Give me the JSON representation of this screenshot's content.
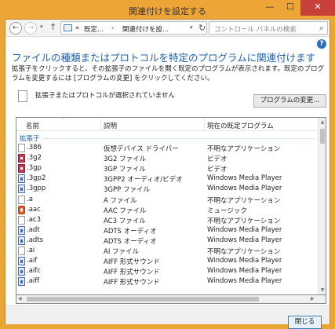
{
  "window": {
    "title": "関連付けを設定する"
  },
  "titlebar": {
    "min": "—",
    "max": "☐",
    "close": "✕"
  },
  "nav": {
    "back": "←",
    "forward": "→",
    "recent": "▾",
    "up": "↑",
    "address": {
      "overflow": "«",
      "crumb1": "既定...",
      "sep": "›",
      "crumb2": "関連付けを設...",
      "chev": "▾",
      "refresh": "↻"
    },
    "search_placeholder": "コントロール パネルの検索"
  },
  "help": "?",
  "heading": "ファイルの種類またはプロトコルを特定のプログラムに関連付けます",
  "description": "拡張子をクリックすると、その拡張子のファイルを開く既定のプログラムが表示されます。既定のプログラムを変更するには [プログラムの変更] をクリックしてください。",
  "selection_text": "拡張子またはプロトコルが選択されていません",
  "change_button": "プログラムの変更...",
  "table": {
    "headers": {
      "name": "名前",
      "description": "説明",
      "program": "現在の既定プログラム"
    },
    "sort": "⌃",
    "group": "拡張子",
    "rows": [
      {
        "name": ".386",
        "description": "仮想デバイス ドライバー",
        "program": "不明なアプリケーション",
        "icon": "doc"
      },
      {
        "name": ".3g2",
        "description": "3G2 ファイル",
        "program": "ビデオ",
        "icon": "red"
      },
      {
        "name": ".3gp",
        "description": "3GP ファイル",
        "program": "ビデオ",
        "icon": "red"
      },
      {
        "name": ".3gp2",
        "description": "3GPP2 オーディオ/ビデオ",
        "program": "Windows Media Player",
        "icon": "blue"
      },
      {
        "name": ".3gpp",
        "description": "3GPP ファイル",
        "program": "Windows Media Player",
        "icon": "blue"
      },
      {
        "name": ".a",
        "description": "A ファイル",
        "program": "不明なアプリケーション",
        "icon": "doc"
      },
      {
        "name": ".aac",
        "description": "AAC ファイル",
        "program": "ミュージック",
        "icon": "orange"
      },
      {
        "name": ".ac3",
        "description": "AC3 ファイル",
        "program": "不明なアプリケーション",
        "icon": "doc"
      },
      {
        "name": ".adt",
        "description": "ADTS オーディオ",
        "program": "Windows Media Player",
        "icon": "blue"
      },
      {
        "name": ".adts",
        "description": "ADTS オーディオ",
        "program": "Windows Media Player",
        "icon": "blue"
      },
      {
        "name": ".ai",
        "description": "AI ファイル",
        "program": "不明なアプリケーション",
        "icon": "doc"
      },
      {
        "name": ".aif",
        "description": "AIFF 形式サウンド",
        "program": "Windows Media Player",
        "icon": "blue"
      },
      {
        "name": ".aifc",
        "description": "AIFF 形式サウンド",
        "program": "Windows Media Player",
        "icon": "blue"
      },
      {
        "name": ".aiff",
        "description": "AIFF 形式サウンド",
        "program": "Windows Media Player",
        "icon": "blue"
      }
    ]
  },
  "scroll": {
    "up": "▲",
    "down": "▼",
    "left": "◀",
    "right": "▶"
  },
  "close_button": "閉じる"
}
